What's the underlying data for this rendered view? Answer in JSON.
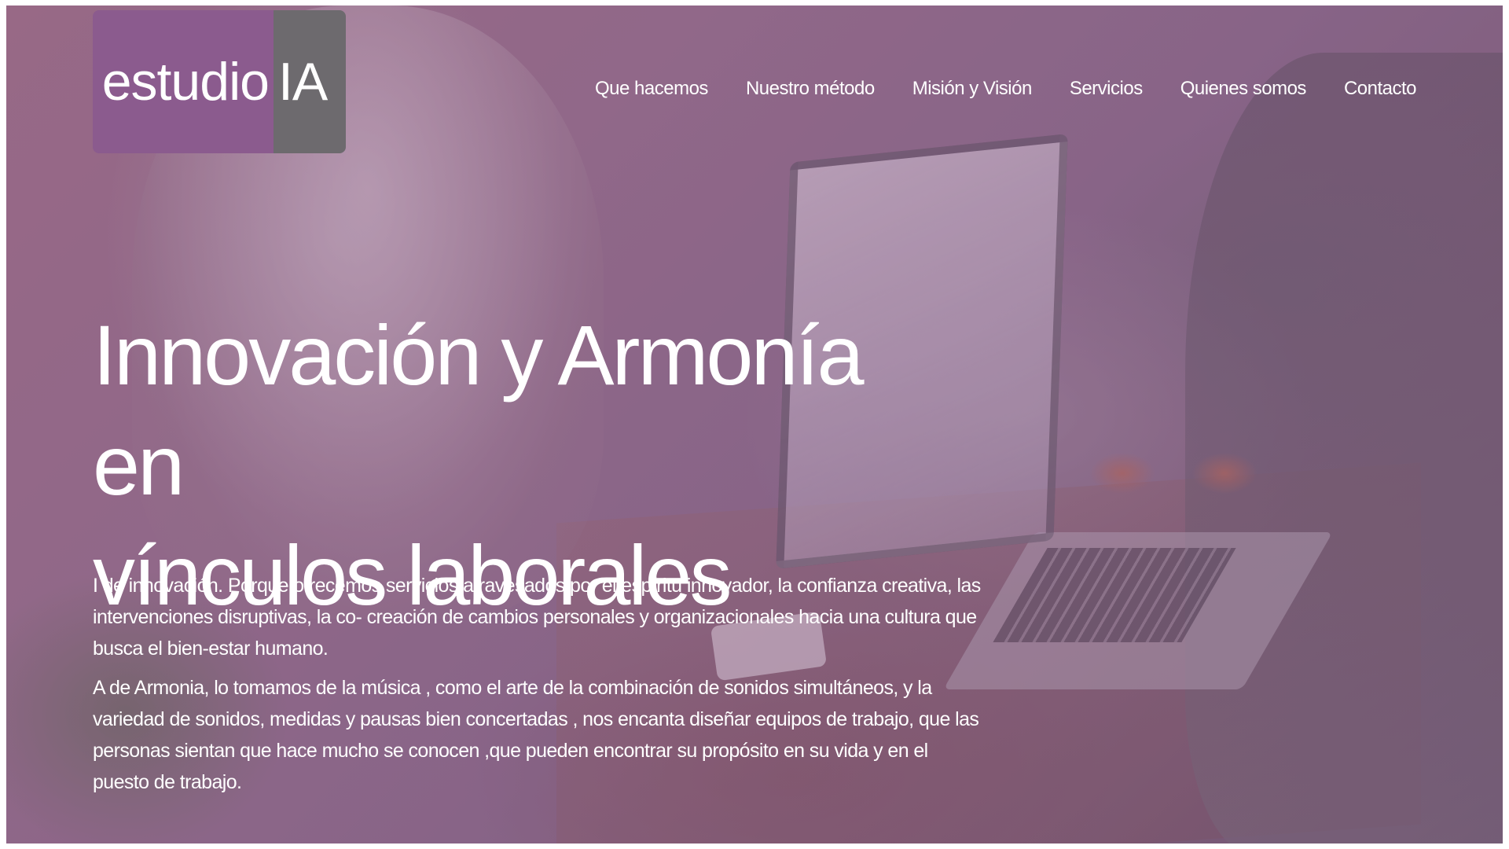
{
  "logo": {
    "part1": "estudio",
    "part2": "IA",
    "color_primary": "#8b5b8e",
    "color_secondary": "#6d6a6e"
  },
  "nav": {
    "items": [
      {
        "label": "Que hacemos"
      },
      {
        "label": "Nuestro método"
      },
      {
        "label": "Misión y Visión"
      },
      {
        "label": "Servicios"
      },
      {
        "label": "Quienes somos"
      },
      {
        "label": "Contacto"
      }
    ]
  },
  "hero": {
    "title_line1": "Innovación y Armonía en",
    "title_line2": "vínculos laborales",
    "paragraph1": "I de innovación. Porque ofrecemos servicios atravesados por el espíritu innovador, la confianza creativa, las intervenciones disruptivas, la co- creación de cambios personales y organizacionales hacia una cultura que busca el bien-estar humano.",
    "paragraph2": "A de Armonia, lo tomamos de la música , como el arte de la combinación de sonidos simultáneos, y la variedad de sonidos, medidas y pausas bien concertadas , nos encanta diseñar equipos de trabajo, que las personas sientan que hace mucho se conocen ,que pueden encontrar su propósito en su vida y en el puesto de trabajo."
  },
  "colors": {
    "overlay": "#784670",
    "text": "#ffffff"
  }
}
